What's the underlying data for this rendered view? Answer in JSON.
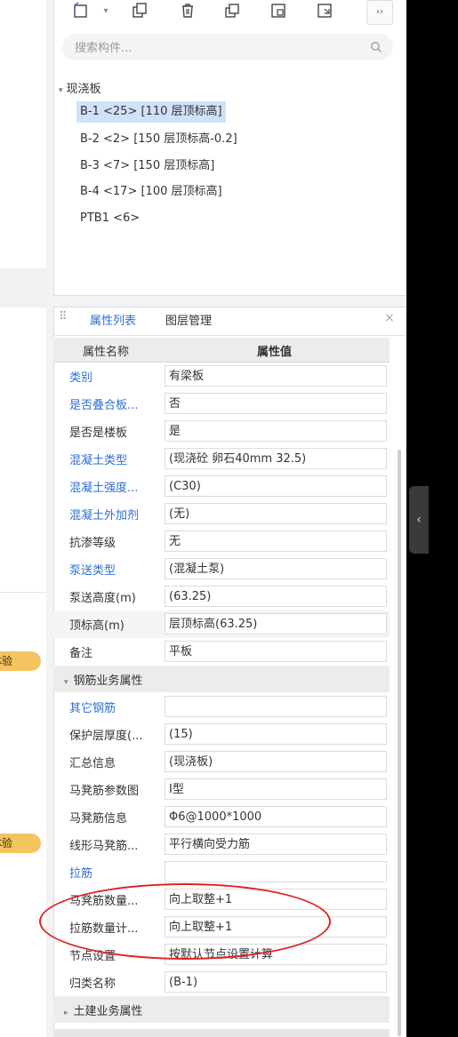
{
  "left_badges": [
    {
      "label": "体验"
    },
    {
      "label": "体验"
    }
  ],
  "toolbar": {
    "icons": [
      "new-component-icon",
      "dropdown-caret-icon",
      "copy-icon",
      "delete-icon",
      "layer-copy-icon",
      "extract-icon",
      "import-icon"
    ],
    "more_label": "››"
  },
  "search": {
    "placeholder": "搜索构件..."
  },
  "tree": {
    "root_label": "现浇板",
    "items": [
      {
        "label": "B-1 <25> [110 层顶标高]",
        "selected": true
      },
      {
        "label": "B-2 <2> [150 层顶标高-0.2]",
        "selected": false
      },
      {
        "label": "B-3 <7> [150 层顶标高]",
        "selected": false
      },
      {
        "label": "B-4 <17> [100 层顶标高]",
        "selected": false
      },
      {
        "label": "PTB1 <6>",
        "selected": false
      }
    ]
  },
  "tabs": {
    "active": "属性列表",
    "other": "图层管理",
    "close": "×"
  },
  "table_header": {
    "name": "属性名称",
    "value": "属性值"
  },
  "rows": [
    {
      "name": "类别",
      "value": "有梁板",
      "blue": true
    },
    {
      "name": "是否叠合板...",
      "value": "否",
      "blue": true
    },
    {
      "name": "是否是楼板",
      "value": "是",
      "blue": false
    },
    {
      "name": "混凝土类型",
      "value": "(现浇砼 卵石40mm 32.5)",
      "blue": true
    },
    {
      "name": "混凝土强度...",
      "value": "(C30)",
      "blue": true
    },
    {
      "name": "混凝土外加剂",
      "value": "(无)",
      "blue": true
    },
    {
      "name": "抗渗等级",
      "value": "无",
      "blue": false
    },
    {
      "name": "泵送类型",
      "value": "(混凝土泵)",
      "blue": true
    },
    {
      "name": "泵送高度(m)",
      "value": "(63.25)",
      "blue": false
    },
    {
      "name": "顶标高(m)",
      "value": "层顶标高(63.25)",
      "blue": false
    },
    {
      "name": "备注",
      "value": "平板",
      "blue": false
    }
  ],
  "group_rebar": {
    "label": "钢筋业务属性"
  },
  "rebar_rows": [
    {
      "name": "其它钢筋",
      "value": "",
      "blue": true
    },
    {
      "name": "保护层厚度(...",
      "value": "(15)",
      "blue": false
    },
    {
      "name": "汇总信息",
      "value": "(现浇板)",
      "blue": false
    },
    {
      "name": "马凳筋参数图",
      "value": "Ⅰ型",
      "blue": false
    },
    {
      "name": "马凳筋信息",
      "value": "Φ6@1000*1000",
      "blue": false
    },
    {
      "name": "线形马凳筋...",
      "value": "平行横向受力筋",
      "blue": false
    },
    {
      "name": "拉筋",
      "value": "",
      "blue": true
    },
    {
      "name": "马凳筋数量...",
      "value": "向上取整+1",
      "blue": false
    },
    {
      "name": "拉筋数量计...",
      "value": "向上取整+1",
      "blue": false
    },
    {
      "name": "节点设置",
      "value": "按默认节点设置计算",
      "blue": false
    },
    {
      "name": "归类名称",
      "value": "(B-1)",
      "blue": false
    }
  ],
  "group_civil": {
    "label": "土建业务属性"
  },
  "side_handle": {
    "label": "‹"
  }
}
